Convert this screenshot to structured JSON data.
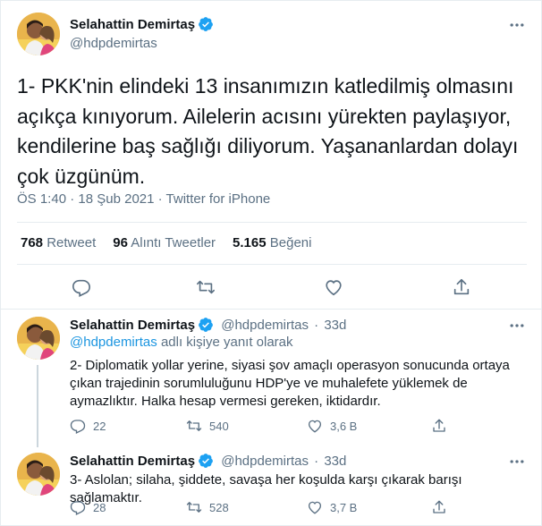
{
  "main_tweet": {
    "display_name": "Selahattin Demirtaş",
    "handle": "@hdpdemirtas",
    "text": "1- PKK'nin elindeki 13 insanımızın katledilmiş olmasını açıkça kınıyorum. Ailelerin acısını yürekten paylaşıyor, kendilerine baş sağlığı diliyorum. Yaşananlardan dolayı çok üzgünüm.",
    "time": "ÖS 1:40",
    "date": "18 Şub 2021",
    "source": "Twitter for iPhone",
    "separator": "·",
    "stats": {
      "retweets_count": "768",
      "retweets_label": "Retweet",
      "quotes_count": "96",
      "quotes_label": "Alıntı Tweetler",
      "likes_count": "5.165",
      "likes_label": "Beğeni"
    }
  },
  "replies": [
    {
      "display_name": "Selahattin Demirtaş",
      "handle": "@hdpdemirtas",
      "age": "33d",
      "separator": "·",
      "reply_to_mention": "@hdpdemirtas",
      "reply_to_suffix": " adlı kişiye yanıt olarak",
      "text": "2- Diplomatik yollar yerine, siyasi şov amaçlı operasyon sonucunda ortaya çıkan trajedinin sorumluluğunu HDP'ye ve muhalefete yüklemek de aymazlıktır. Halka hesap vermesi gereken, iktidardır.",
      "replies_count": "22",
      "retweets_count": "540",
      "likes_count": "3,6 B"
    },
    {
      "display_name": "Selahattin Demirtaş",
      "handle": "@hdpdemirtas",
      "age": "33d",
      "separator": "·",
      "text": "3- Aslolan; silaha, şiddete, savaşa her koşulda karşı çıkarak barışı sağlamaktır.",
      "replies_count": "28",
      "retweets_count": "528",
      "likes_count": "3,7 B"
    }
  ],
  "icons": {
    "verified": "verified-badge-icon",
    "more": "more-icon",
    "reply": "reply-icon",
    "retweet": "retweet-icon",
    "like": "heart-icon",
    "share": "share-icon"
  },
  "colors": {
    "text": "#0f1419",
    "secondary": "#5b7083",
    "link": "#1b95e0",
    "verified": "#1da1f2",
    "border": "#e6ecf0"
  }
}
